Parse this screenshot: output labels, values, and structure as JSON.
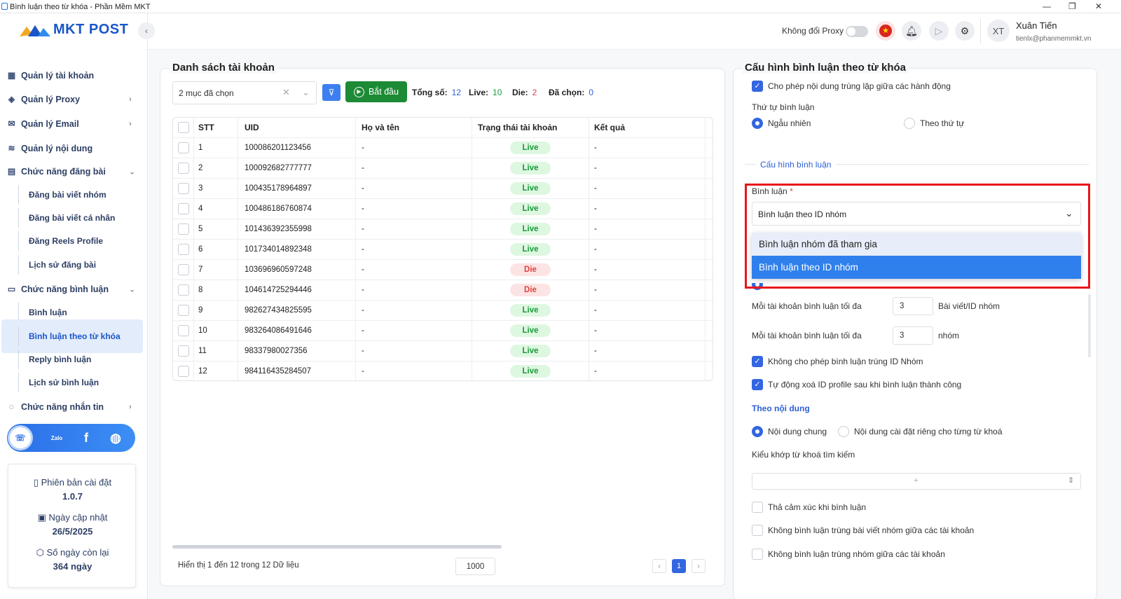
{
  "window": {
    "title": "Bình luận theo từ khóa - Phần Mềm MKT",
    "controls": [
      "—",
      "❐",
      "✕"
    ]
  },
  "brand": {
    "logo_text": "MKT POST",
    "accent": "#1a56c9"
  },
  "sidebar": {
    "collapse_icon": "‹",
    "items": [
      {
        "label": "Quản lý tài khoản",
        "icon": "grid-icon"
      },
      {
        "label": "Quản lý Proxy",
        "icon": "layers-icon"
      },
      {
        "label": "Quản lý Email",
        "icon": "mail-icon"
      },
      {
        "label": "Quản lý nội dung",
        "icon": "content-icon"
      },
      {
        "label": "Chức năng đăng bài",
        "icon": "post-icon"
      },
      {
        "label": "Chức năng bình luận",
        "icon": "comment-icon"
      },
      {
        "label": "Chức năng nhắn tin",
        "icon": "message-icon"
      }
    ],
    "post_sub": [
      "Đăng bài viết nhóm",
      "Đăng bài viết cá nhân",
      "Đăng Reels Profile",
      "Lịch sử đăng bài"
    ],
    "comment_sub": [
      "Bình luận",
      "Bình luận theo từ khóa",
      "Reply bình luận",
      "Lịch sử bình luận"
    ],
    "social": {
      "zalo": "Zalo",
      "facebook": "f"
    },
    "info": {
      "version_label": "Phiên bản cài đặt",
      "version": "1.0.7",
      "update_label": "Ngày cập nhật",
      "update": "26/5/2025",
      "days_label": "Số ngày còn lại",
      "days": "364 ngày"
    }
  },
  "header": {
    "proxy_label": "Không đổi Proxy",
    "avatar": "XT",
    "user_name": "Xuân Tiến",
    "user_email": "tienlx@phanmemmkt.vn"
  },
  "accounts": {
    "title": "Danh sách tài khoản",
    "select_value": "2 mục đã chọn",
    "start_label": "Bắt đầu",
    "stats": {
      "total_label": "Tổng số:",
      "total": "12",
      "live_label": "Live:",
      "live": "10",
      "die_label": "Die:",
      "die": "2",
      "selected_label": "Đã chọn:",
      "selected": "0"
    },
    "columns": [
      "STT",
      "UID",
      "Họ và tên",
      "Trạng thái tài khoản",
      "Kết quả"
    ],
    "rows": [
      {
        "stt": "1",
        "uid": "100086201123456",
        "name": "-",
        "status": "Live",
        "result": "-"
      },
      {
        "stt": "2",
        "uid": "100092682777777",
        "name": "-",
        "status": "Live",
        "result": "-"
      },
      {
        "stt": "3",
        "uid": "100435178964897",
        "name": "-",
        "status": "Live",
        "result": "-"
      },
      {
        "stt": "4",
        "uid": "100486186760874",
        "name": "-",
        "status": "Live",
        "result": "-"
      },
      {
        "stt": "5",
        "uid": "101436392355998",
        "name": "-",
        "status": "Live",
        "result": "-"
      },
      {
        "stt": "6",
        "uid": "101734014892348",
        "name": "-",
        "status": "Live",
        "result": "-"
      },
      {
        "stt": "7",
        "uid": "103696960597248",
        "name": "-",
        "status": "Die",
        "result": "-"
      },
      {
        "stt": "8",
        "uid": "104614725294446",
        "name": "-",
        "status": "Die",
        "result": "-"
      },
      {
        "stt": "9",
        "uid": "982627434825595",
        "name": "-",
        "status": "Live",
        "result": "-"
      },
      {
        "stt": "10",
        "uid": "983264086491646",
        "name": "-",
        "status": "Live",
        "result": "-"
      },
      {
        "stt": "11",
        "uid": "98337980027356",
        "name": "-",
        "status": "Live",
        "result": "-"
      },
      {
        "stt": "12",
        "uid": "984116435284507",
        "name": "-",
        "status": "Live",
        "result": "-"
      }
    ],
    "footer_text": "Hiển thị 1 đến 12 trong 12 Dữ liệu",
    "page_size": "1000",
    "current_page": "1"
  },
  "config": {
    "title": "Cấu hình bình luận theo từ khóa",
    "allow_dup": "Cho phép nội dung trùng lặp giữa các hành động",
    "order_label": "Thứ tự bình luận",
    "order_random": "Ngẫu nhiên",
    "order_sequence": "Theo thứ tự",
    "comment_config": "Cấu hình bình luận",
    "comment_label": "Bình luận",
    "required_mark": "*",
    "comment_value": "Bình luận theo ID nhóm",
    "options": [
      "Bình luận nhóm đã tham gia",
      "Bình luận theo ID nhóm"
    ],
    "max1_label": "Mỗi tài khoản bình luận tối đa",
    "max1_value": "3",
    "max1_unit": "Bài viết/ID nhóm",
    "max2_label": "Mỗi tài khoản bình luận tối đa",
    "max2_value": "3",
    "max2_unit": "nhóm",
    "no_dup_id": "Không cho phép bình luận trùng ID Nhóm",
    "auto_delete": "Tự động xoá ID profile sau khi bình luận thành công",
    "by_content": "Theo nội dung",
    "content_common": "Nội dung chung",
    "content_custom": "Nội dung cài đặt riêng cho từng từ khoá",
    "match_label": "Kiểu khớp từ khoá tìm kiếm",
    "match_value": "",
    "reaction": "Thả cảm xúc khi bình luận",
    "no_dup_post": "Không bình luận trùng bài viết nhóm giữa các tài khoản",
    "no_dup_group": "Không bình luận trùng nhóm giữa các tài khoản"
  }
}
